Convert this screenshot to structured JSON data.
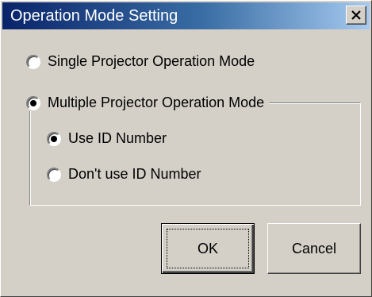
{
  "window": {
    "title": "Operation Mode Setting",
    "close_label": "X"
  },
  "mode": {
    "single_label": "Single Projector Operation Mode",
    "single_selected": false,
    "multiple_label": "Multiple Projector Operation Mode",
    "multiple_selected": true
  },
  "id_option": {
    "use_label": "Use ID Number",
    "use_selected": true,
    "dont_use_label": "Don't use ID Number",
    "dont_use_selected": false
  },
  "buttons": {
    "ok_label": "OK",
    "cancel_label": "Cancel"
  }
}
